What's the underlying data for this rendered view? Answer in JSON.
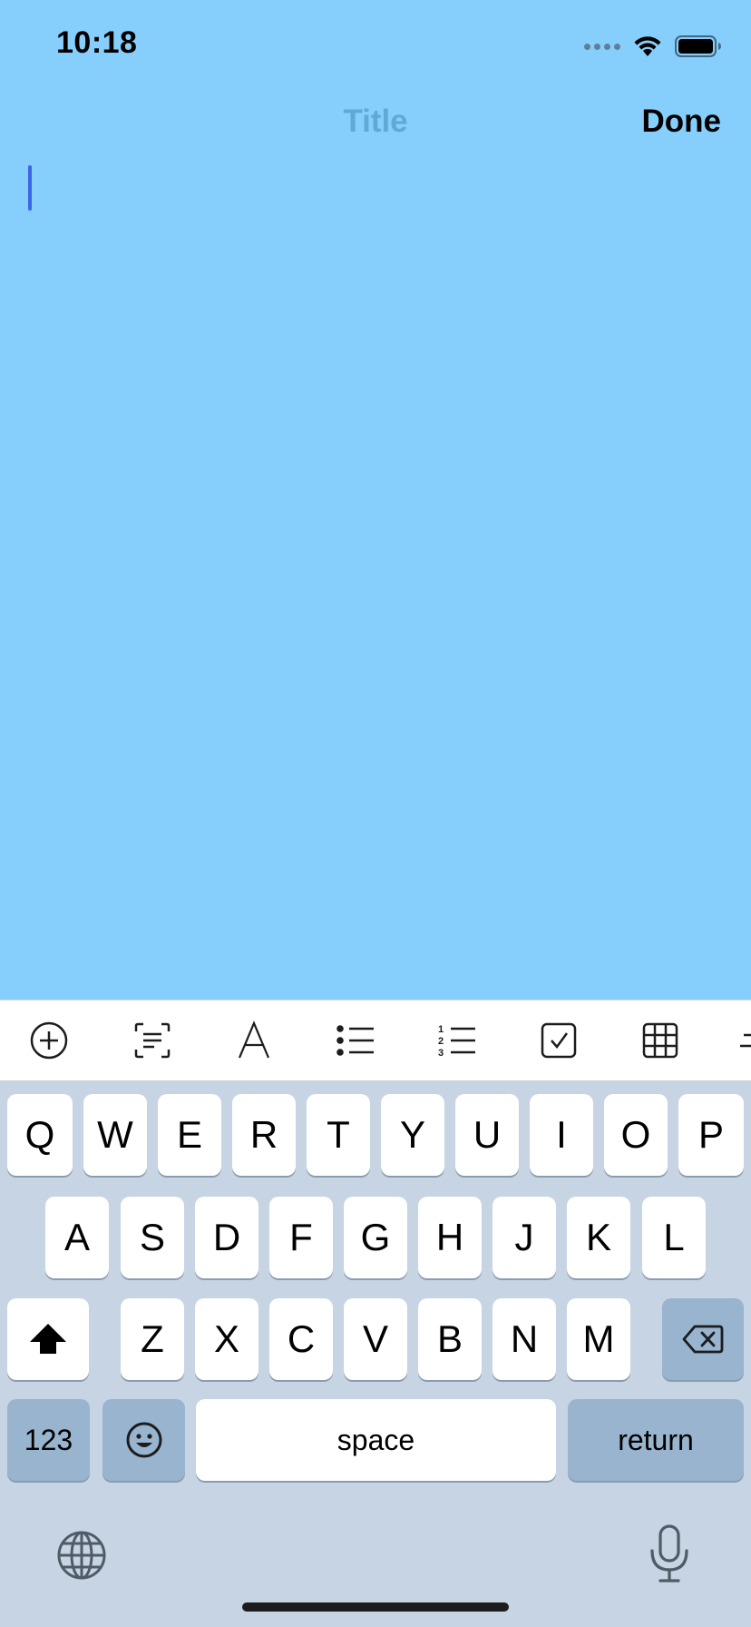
{
  "status_bar": {
    "time": "10:18",
    "icons": [
      "signal-dots-icon",
      "wifi-icon",
      "battery-icon"
    ]
  },
  "nav": {
    "title": "Title",
    "done_label": "Done"
  },
  "toolbar": {
    "tools": [
      "add-attachment-icon",
      "scan-text-icon",
      "text-format-icon",
      "bulleted-list-icon",
      "numbered-list-icon",
      "checklist-icon",
      "table-icon",
      "more-icon"
    ]
  },
  "keyboard": {
    "row1": [
      "Q",
      "W",
      "E",
      "R",
      "T",
      "Y",
      "U",
      "I",
      "O",
      "P"
    ],
    "row2": [
      "A",
      "S",
      "D",
      "F",
      "G",
      "H",
      "J",
      "K",
      "L"
    ],
    "row3": [
      "Z",
      "X",
      "C",
      "V",
      "B",
      "N",
      "M"
    ],
    "numbers_label": "123",
    "space_label": "space",
    "return_label": "return"
  },
  "colors": {
    "background": "#86cffd",
    "cursor": "#3d66e8",
    "keyboard_bg": "#c6d4e3"
  }
}
